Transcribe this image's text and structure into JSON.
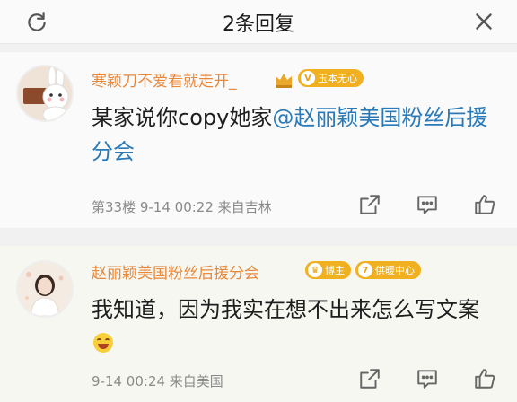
{
  "header": {
    "title": "2条回复",
    "refresh_icon": "refresh-icon",
    "close_icon": "close-icon"
  },
  "comments": [
    {
      "username": "寒颖刀不爱看就走开_",
      "badges": [
        {
          "icon": "crown-icon"
        },
        {
          "label": "玉本无心",
          "icon": "v-icon",
          "color": "#f0b020"
        }
      ],
      "text_plain": "某家说你copy她家",
      "mention": "@赵丽颖美国粉丝后援分会",
      "meta": "第33楼  9-14 00:22  来自吉林",
      "avatar": "rabbit-avatar"
    },
    {
      "username": "赵丽颖美国粉丝后援分会",
      "badges": [
        {
          "label": "博主",
          "icon": "crown-icon",
          "color": "#f0b020"
        },
        {
          "label": "供暖中心",
          "icon": "7",
          "color": "#f0b020"
        }
      ],
      "text_plain": "我知道，因为我实在想不出来怎么写文案",
      "emoji": "laugh-cry-emoji",
      "meta": "9-14 00:24  来自美国",
      "avatar": "woman-avatar"
    }
  ],
  "actions": [
    "share-icon",
    "comment-icon",
    "like-icon"
  ],
  "colors": {
    "username": "#e8883a",
    "mention": "#2a7ab8",
    "meta": "#8a8a8a",
    "badge": "#f0b020"
  }
}
